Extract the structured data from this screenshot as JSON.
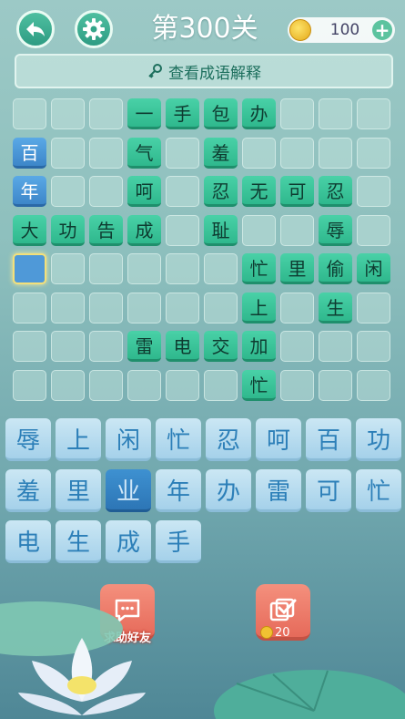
{
  "header": {
    "level_title": "第300关",
    "coins": "100"
  },
  "explain_label": "查看成语解释",
  "grid": [
    {
      "r": 0,
      "c": 3,
      "t": "一",
      "s": "green"
    },
    {
      "r": 0,
      "c": 4,
      "t": "手",
      "s": "green"
    },
    {
      "r": 0,
      "c": 5,
      "t": "包",
      "s": "green"
    },
    {
      "r": 0,
      "c": 6,
      "t": "办",
      "s": "green"
    },
    {
      "r": 1,
      "c": 0,
      "t": "百",
      "s": "blue"
    },
    {
      "r": 1,
      "c": 3,
      "t": "气",
      "s": "green"
    },
    {
      "r": 1,
      "c": 5,
      "t": "羞",
      "s": "green"
    },
    {
      "r": 2,
      "c": 0,
      "t": "年",
      "s": "blue"
    },
    {
      "r": 2,
      "c": 3,
      "t": "呵",
      "s": "green"
    },
    {
      "r": 2,
      "c": 5,
      "t": "忍",
      "s": "green"
    },
    {
      "r": 2,
      "c": 6,
      "t": "无",
      "s": "green"
    },
    {
      "r": 2,
      "c": 7,
      "t": "可",
      "s": "green"
    },
    {
      "r": 2,
      "c": 8,
      "t": "忍",
      "s": "green"
    },
    {
      "r": 3,
      "c": 0,
      "t": "大",
      "s": "green"
    },
    {
      "r": 3,
      "c": 1,
      "t": "功",
      "s": "green"
    },
    {
      "r": 3,
      "c": 2,
      "t": "告",
      "s": "green"
    },
    {
      "r": 3,
      "c": 3,
      "t": "成",
      "s": "green"
    },
    {
      "r": 3,
      "c": 5,
      "t": "耻",
      "s": "green"
    },
    {
      "r": 3,
      "c": 8,
      "t": "辱",
      "s": "green"
    },
    {
      "r": 4,
      "c": 0,
      "t": "",
      "s": "selected"
    },
    {
      "r": 4,
      "c": 6,
      "t": "忙",
      "s": "green"
    },
    {
      "r": 4,
      "c": 7,
      "t": "里",
      "s": "green"
    },
    {
      "r": 4,
      "c": 8,
      "t": "偷",
      "s": "green"
    },
    {
      "r": 4,
      "c": 9,
      "t": "闲",
      "s": "green"
    },
    {
      "r": 5,
      "c": 6,
      "t": "上",
      "s": "green"
    },
    {
      "r": 5,
      "c": 8,
      "t": "生",
      "s": "green"
    },
    {
      "r": 6,
      "c": 3,
      "t": "雷",
      "s": "green"
    },
    {
      "r": 6,
      "c": 4,
      "t": "电",
      "s": "green"
    },
    {
      "r": 6,
      "c": 5,
      "t": "交",
      "s": "green"
    },
    {
      "r": 6,
      "c": 6,
      "t": "加",
      "s": "green"
    },
    {
      "r": 7,
      "c": 6,
      "t": "忙",
      "s": "green"
    }
  ],
  "pool": [
    {
      "t": "辱",
      "used": false
    },
    {
      "t": "上",
      "used": false
    },
    {
      "t": "闲",
      "used": false
    },
    {
      "t": "忙",
      "used": false
    },
    {
      "t": "忍",
      "used": false
    },
    {
      "t": "呵",
      "used": false
    },
    {
      "t": "百",
      "used": false
    },
    {
      "t": "功",
      "used": false
    },
    {
      "t": "羞",
      "used": false
    },
    {
      "t": "里",
      "used": false
    },
    {
      "t": "业",
      "used": true
    },
    {
      "t": "年",
      "used": false
    },
    {
      "t": "办",
      "used": false
    },
    {
      "t": "雷",
      "used": false
    },
    {
      "t": "可",
      "used": false
    },
    {
      "t": "忙",
      "used": false
    },
    {
      "t": "电",
      "used": false
    },
    {
      "t": "生",
      "used": false
    },
    {
      "t": "成",
      "used": false
    },
    {
      "t": "手",
      "used": false
    }
  ],
  "actions": {
    "help_label": "求助好友",
    "answer_cost": "20"
  }
}
